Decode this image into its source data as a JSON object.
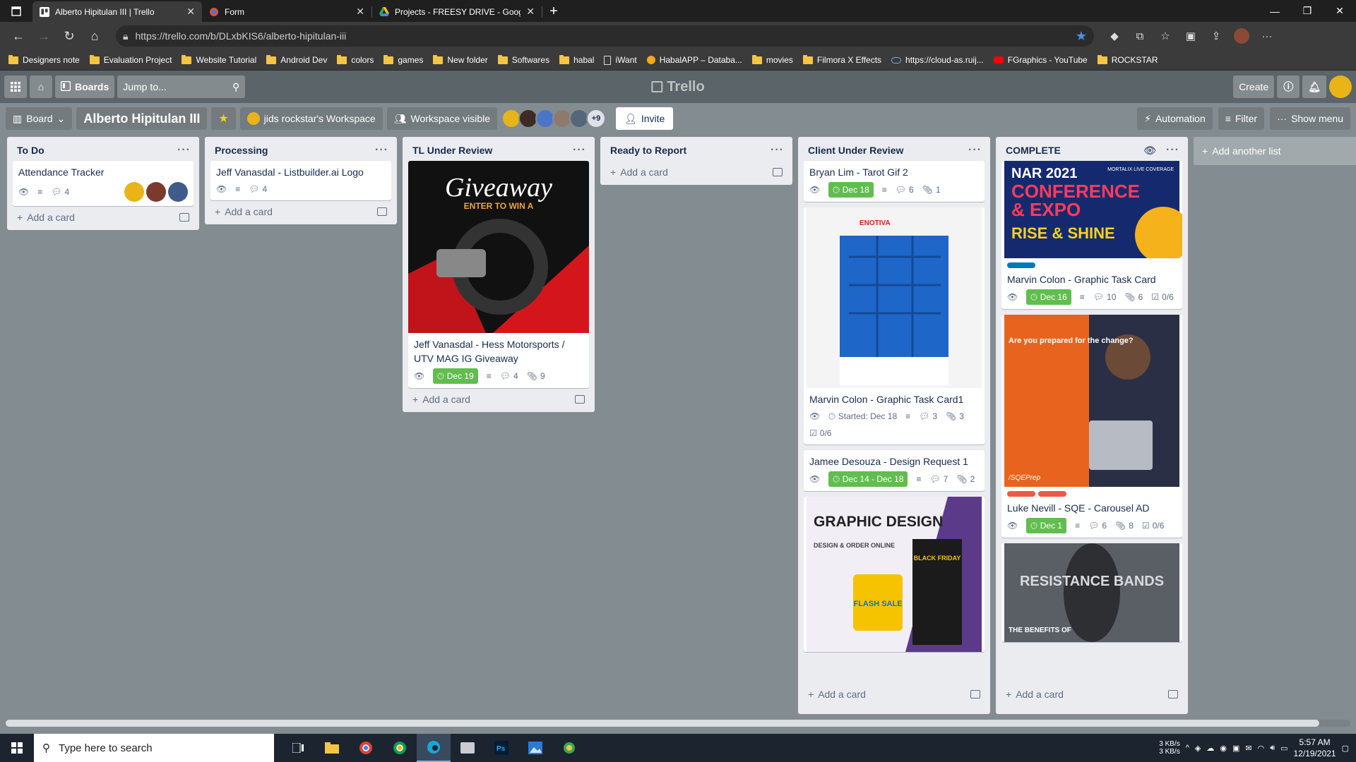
{
  "browser": {
    "tabs": [
      {
        "title": "Alberto Hipitulan III | Trello",
        "active": true
      },
      {
        "title": "Form",
        "active": false
      },
      {
        "title": "Projects - FREESY DRIVE - Googl",
        "active": false
      }
    ],
    "url": "https://trello.com/b/DLxbKIS6/alberto-hipitulan-iii",
    "bookmarks": [
      "Designers note",
      "Evaluation Project",
      "Website Tutorial",
      "Android Dev",
      "colors",
      "games",
      "New folder",
      "Softwares",
      "habal",
      "iWant",
      "HabalAPP – Databa...",
      "movies",
      "Filmora X Effects",
      "https://cloud-as.ruij...",
      "FGraphics - YouTube",
      "ROCKSTAR"
    ]
  },
  "trello": {
    "boards_label": "Boards",
    "jump_placeholder": "Jump to...",
    "logo": "Trello",
    "create_label": "Create"
  },
  "board": {
    "view_label": "Board",
    "title": "Alberto Hipitulan III",
    "workspace": "jids rockstar's Workspace",
    "visibility": "Workspace visible",
    "more_members": "+9",
    "invite_label": "Invite",
    "automation_label": "Automation",
    "filter_label": "Filter",
    "menu_label": "Show menu",
    "add_card": "Add a card",
    "add_list": "Add another list"
  },
  "lists": [
    {
      "name": "To Do",
      "cards": [
        {
          "title": "Attendance Tracker",
          "comments": "4"
        }
      ]
    },
    {
      "name": "Processing",
      "cards": [
        {
          "title": "Jeff Vanasdal - Listbuilder.ai Logo",
          "comments": "4"
        }
      ]
    },
    {
      "name": "TL Under Review",
      "cards": [
        {
          "title": "Jeff Vanasdal - Hess Motorsports / UTV MAG IG Giveaway",
          "due": "Dec 19",
          "comments": "4",
          "attachments": "9",
          "cover_text": "Giveaway",
          "cover_sub": "ENTER TO WIN A"
        }
      ]
    },
    {
      "name": "Ready to Report",
      "cards": []
    },
    {
      "name": "Client Under Review",
      "cards": [
        {
          "title": "Bryan Lim - Tarot Gif 2",
          "due": "Dec 18",
          "comments": "6",
          "attachments": "1"
        },
        {
          "title": "Marvin Colon - Graphic Task Card1",
          "started": "Started: Dec 18",
          "comments": "3",
          "attachments": "3",
          "checklist": "0/6",
          "cover_text": "ENOTIVA"
        },
        {
          "title": "Jamee Desouza - Design Request 1",
          "due": "Dec 14 - Dec 18",
          "comments": "7",
          "attachments": "2"
        },
        {
          "cover_text": "GRAPHIC DESIGN",
          "cover_sub": "DESIGN & ORDER ONLINE",
          "cover_tag1": "FLASH SALE",
          "cover_tag2": "BLACK FRIDAY"
        }
      ]
    },
    {
      "name": "COMPLETE",
      "cards": [
        {
          "title": "Marvin Colon - Graphic Task Card",
          "due": "Dec 16",
          "comments": "10",
          "attachments": "6",
          "checklist": "0/6",
          "cover_text1": "NAR 2021",
          "cover_text2": "CONFERENCE",
          "cover_text3": "& EXPO",
          "cover_text4": "RISE & SHINE",
          "cover_tag": "MORTALIX LIVE COVERAGE"
        },
        {
          "title": "Luke Nevill - SQE - Carousel AD",
          "due": "Dec 1",
          "comments": "6",
          "attachments": "8",
          "checklist": "0/6",
          "cover_text": "Are you prepared for the change?",
          "cover_brand": "/SQEPrep"
        },
        {
          "cover_text": "RESISTANCE BANDS",
          "cover_sub": "THE BENEFITS OF"
        }
      ]
    }
  ],
  "taskbar": {
    "search_placeholder": "Type here to search",
    "net_up": "3 KB/s",
    "net_down": "3 KB/s",
    "time": "5:57 AM",
    "date": "12/19/2021"
  },
  "colors": {
    "due_green": "#61bd4f",
    "board_bg": "#838c91",
    "header_bg": "#5b6468"
  }
}
